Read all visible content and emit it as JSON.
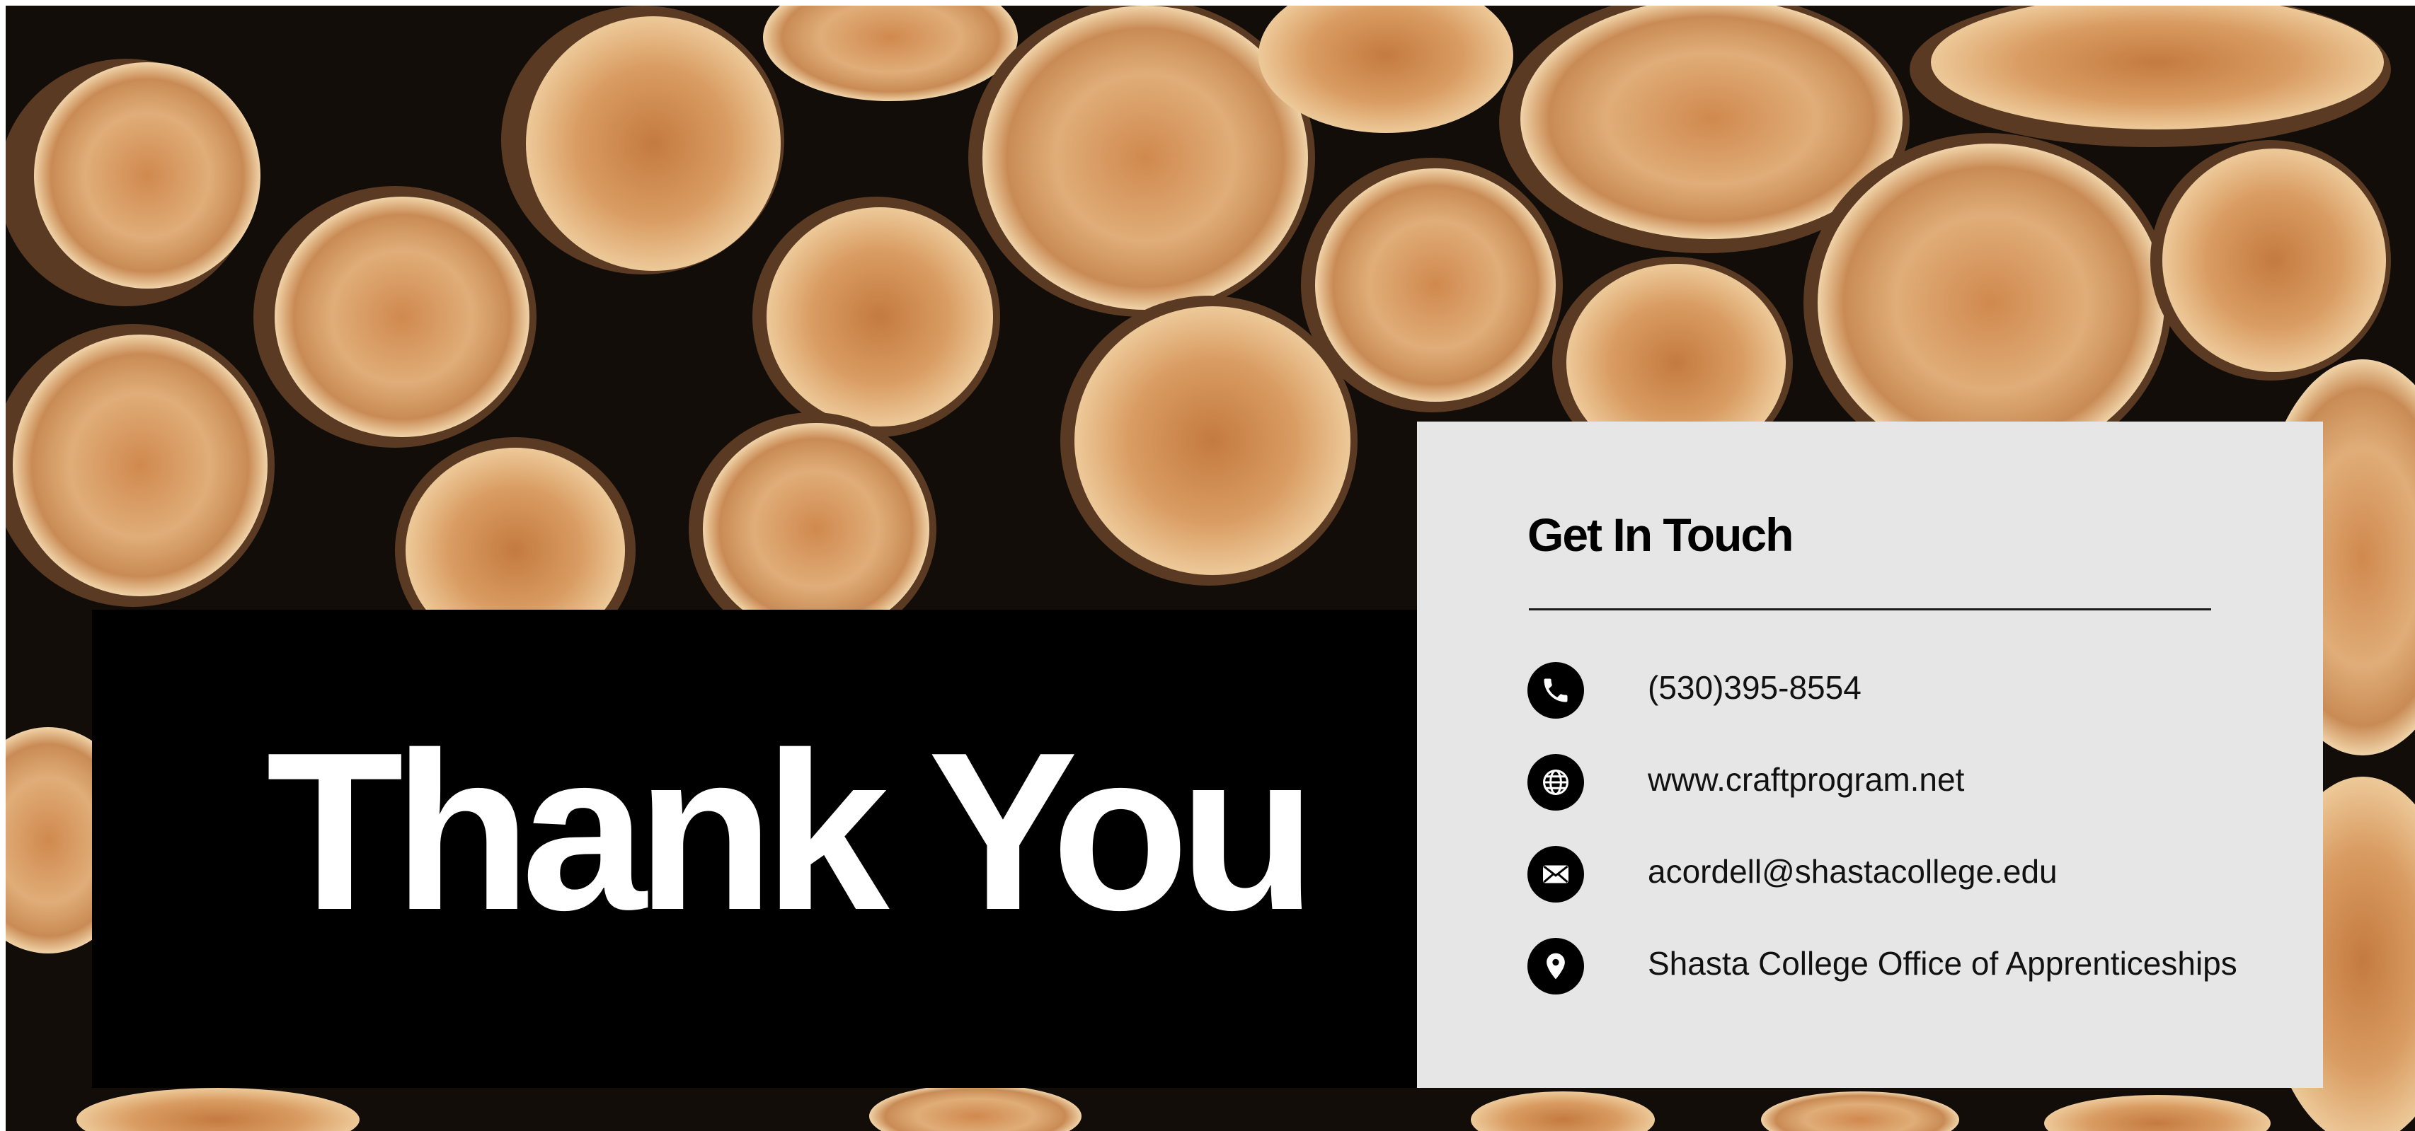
{
  "slide": {
    "title": "Thank You"
  },
  "contact": {
    "heading": "Get In Touch",
    "items": [
      {
        "icon": "phone-icon",
        "text": "(530)395-8554"
      },
      {
        "icon": "globe-icon",
        "text": "www.craftprogram.net"
      },
      {
        "icon": "email-icon",
        "text": "acordell@shastacollege.edu"
      },
      {
        "icon": "location-pin-icon",
        "text": "Shasta College Office of Apprenticeships"
      }
    ]
  },
  "colors": {
    "thanks_panel": "#000000",
    "thanks_text": "#ffffff",
    "card_background": "#e6e6e6",
    "icon_circle": "#000000",
    "wood_light": "#d9a36b",
    "wood_dark": "#9a5a2c",
    "bark": "#4a2f1c"
  }
}
